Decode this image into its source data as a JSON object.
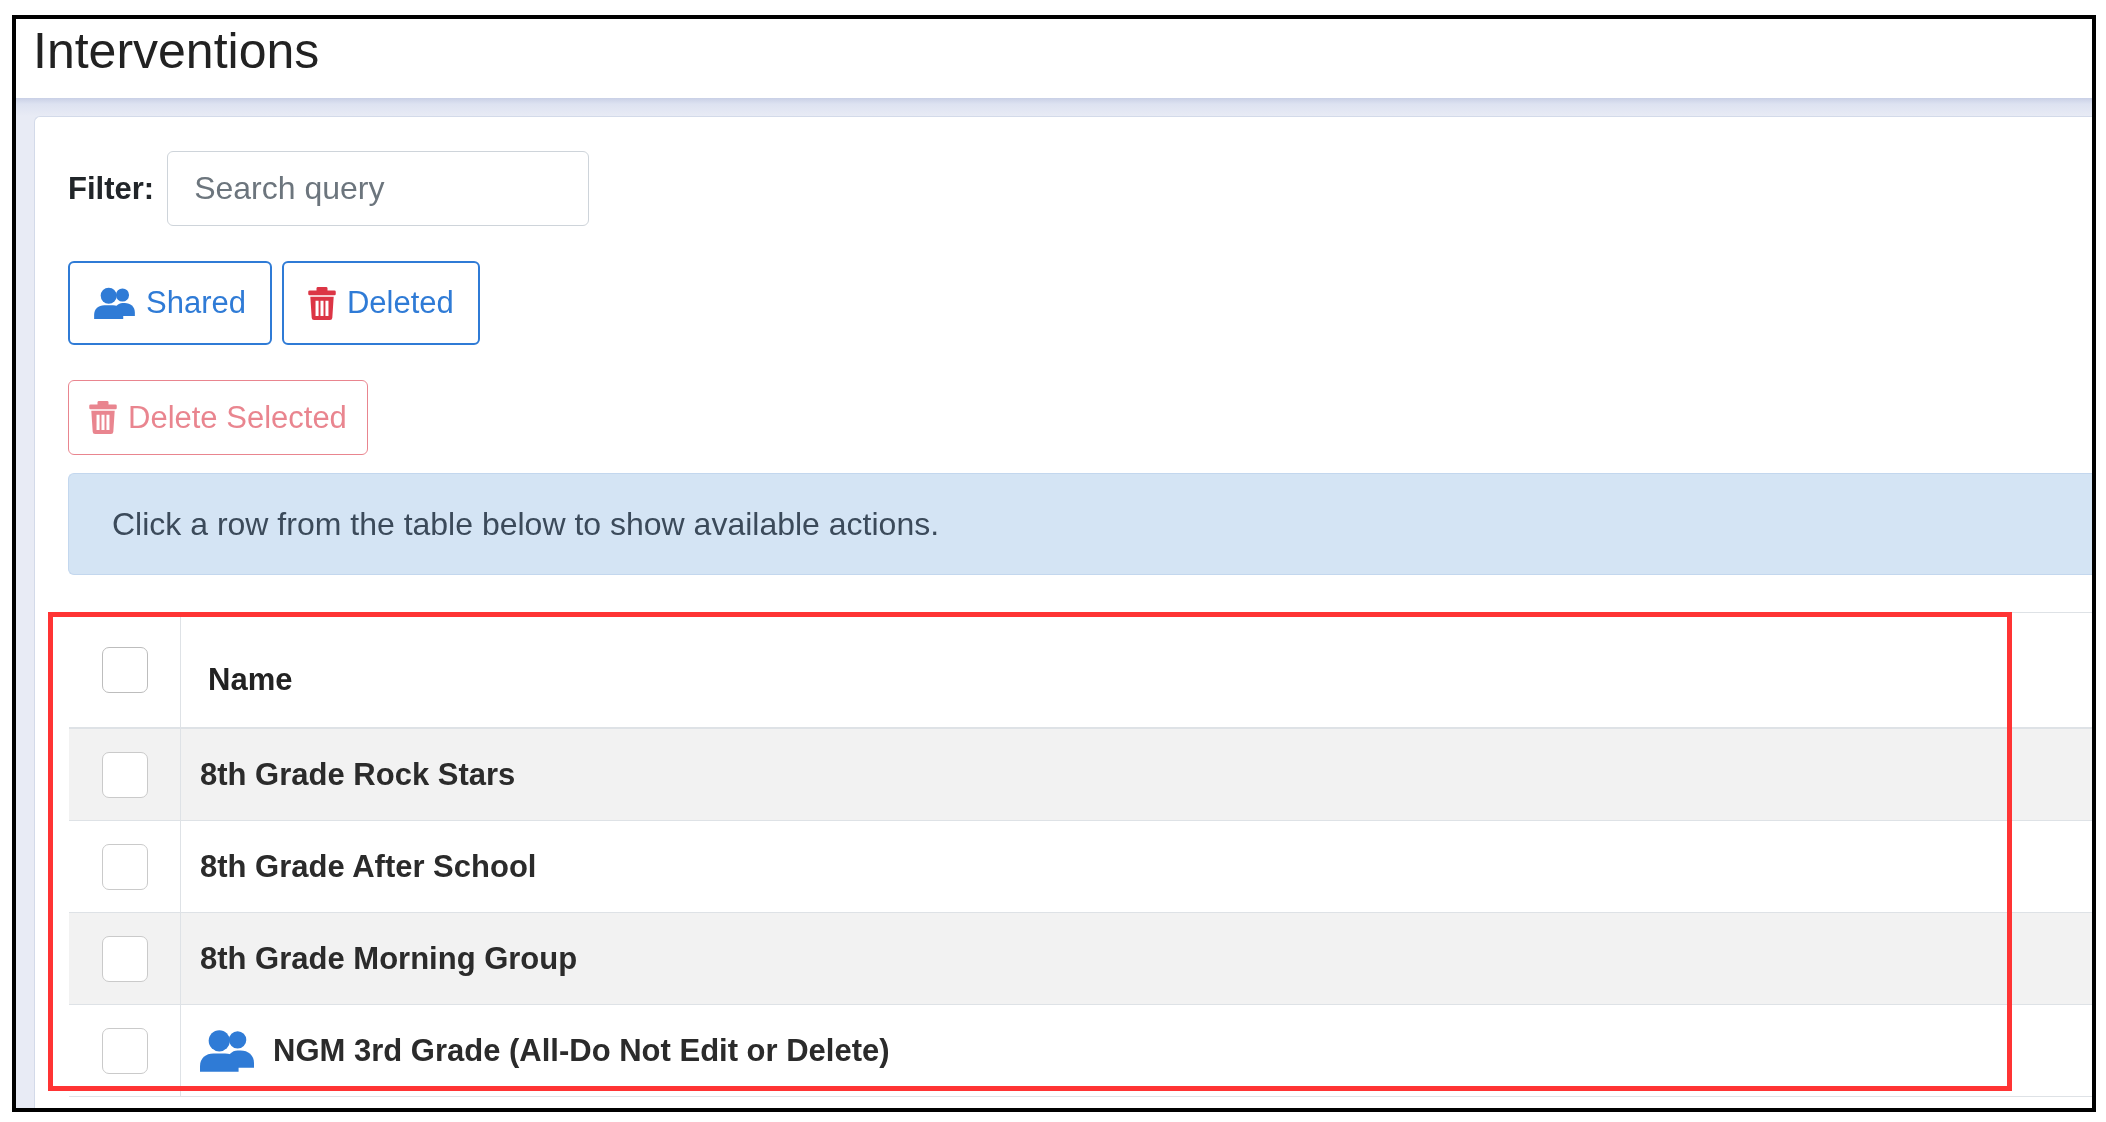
{
  "page": {
    "title": "Interventions"
  },
  "filter": {
    "label": "Filter:",
    "placeholder": "Search query"
  },
  "view_buttons": [
    {
      "kind": "shared",
      "label": "Shared"
    },
    {
      "kind": "deleted",
      "label": "Deleted"
    }
  ],
  "delete_selected": {
    "label": "Delete Selected",
    "disabled": true
  },
  "info_message": "Click a row from the table below to show available actions.",
  "table": {
    "select_all": {
      "checked": false
    },
    "columns": [
      "Name"
    ],
    "rows": [
      {
        "name": "8th Grade Rock Stars",
        "checked": false,
        "shared": false
      },
      {
        "name": "8th Grade After School",
        "checked": false,
        "shared": false
      },
      {
        "name": "8th Grade Morning Group",
        "checked": false,
        "shared": false
      },
      {
        "name": "NGM 3rd Grade (All-Do Not Edit or Delete)",
        "checked": false,
        "shared": true
      }
    ]
  }
}
